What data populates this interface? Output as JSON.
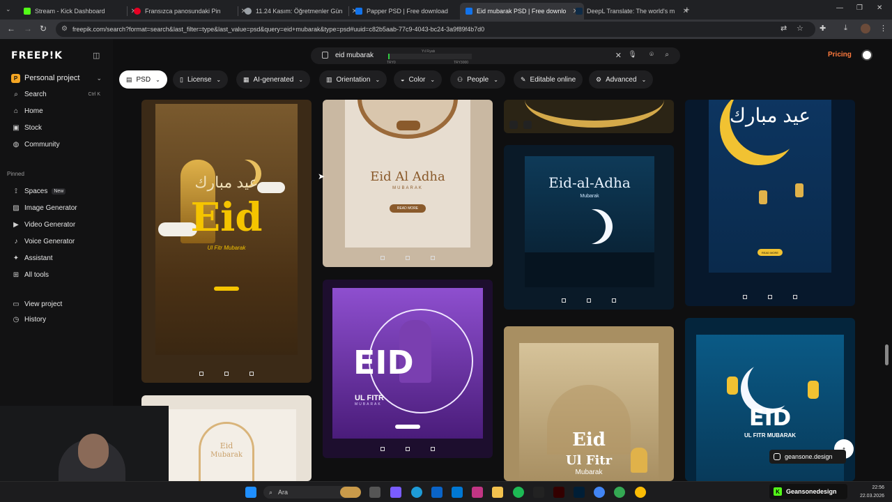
{
  "browser": {
    "tabs": [
      {
        "title": "Stream - Kick Dashboard",
        "icon": "kick-icon",
        "color": "#53fc18"
      },
      {
        "title": "Fransızca panosundaki Pin",
        "icon": "pinterest-icon",
        "color": "#e60023"
      },
      {
        "title": "11.24 Kasım: Öğretmenler Gün",
        "icon": "globe-icon",
        "color": "#9aa0a6"
      },
      {
        "title": "Papper PSD | Free download",
        "icon": "freepik-icon",
        "color": "#1273eb"
      },
      {
        "title": "Eid mubarak PSD | Free downlo",
        "icon": "freepik-icon",
        "color": "#1273eb"
      },
      {
        "title": "DeepL Translate: The world's m",
        "icon": "deepl-icon",
        "color": "#0f2b46"
      }
    ],
    "active_tab": 4,
    "url": "freepik.com/search?format=search&last_filter=type&last_value=psd&query=eid+mubarak&type=psd#uuid=c82b5aab-77c9-4043-bc24-3a9f89f4b7d0"
  },
  "app": {
    "logo": "FREEP!K",
    "project": {
      "label": "Personal project"
    },
    "nav": [
      {
        "label": "Search",
        "icon": "search-icon",
        "shortcut": "Ctrl K"
      },
      {
        "label": "Home",
        "icon": "home-icon"
      },
      {
        "label": "Stock",
        "icon": "stock-icon"
      },
      {
        "label": "Community",
        "icon": "globe-icon"
      }
    ],
    "pinned_label": "Pinned",
    "pinned": [
      {
        "label": "Spaces",
        "icon": "spaces-icon",
        "badge": "New"
      },
      {
        "label": "Image Generator",
        "icon": "image-icon"
      },
      {
        "label": "Video Generator",
        "icon": "video-icon"
      },
      {
        "label": "Voice Generator",
        "icon": "voice-icon"
      },
      {
        "label": "Assistant",
        "icon": "assistant-icon"
      },
      {
        "label": "All tools",
        "icon": "grid-icon"
      }
    ],
    "footer": [
      {
        "label": "View project",
        "icon": "project-icon"
      },
      {
        "label": "History",
        "icon": "history-icon"
      }
    ],
    "search": {
      "query": "eid mubarak"
    },
    "rate_widget": {
      "left": "TRY0",
      "right": "TRY3000",
      "top": "Yıl Fiyatı",
      "value_fraction": 0.02
    },
    "pricing": "Pricing",
    "filters": [
      {
        "label": "PSD",
        "icon": "file-icon",
        "active": true
      },
      {
        "label": "License",
        "icon": "license-icon"
      },
      {
        "label": "AI-generated",
        "icon": "ai-icon"
      },
      {
        "label": "Orientation",
        "icon": "orientation-icon"
      },
      {
        "label": "Color",
        "icon": "color-icon"
      },
      {
        "label": "People",
        "icon": "people-icon"
      },
      {
        "label": "Editable online",
        "icon": "pencil-icon",
        "no_chevron": true
      },
      {
        "label": "Advanced",
        "icon": "settings-icon"
      }
    ],
    "cards": [
      {
        "title": "Eid",
        "subtitle": "Ul Fitr Mubarak",
        "arabic": "عيد مبارك",
        "bg": "#5a3c1a",
        "accent": "#f5c400"
      },
      {
        "title": "Eid Al Adha",
        "subtitle": "MUBARAK",
        "button": "READ MORE",
        "bg": "#dccbb5",
        "accent": "#8a5a2b"
      },
      {
        "title": "Eid-al-Adha",
        "subtitle": "Mubarak",
        "bg": "#0b2a40",
        "accent": "#cfe8ff"
      },
      {
        "title": "عيد مبارك",
        "button": "READ MORE",
        "bg": "#0d3560",
        "accent": "#f5c400"
      },
      {
        "title": "EID",
        "subtitle": "UL FITR",
        "subtitle2": "MUBARAK",
        "bg": "#6a2a9e",
        "accent": "#ffffff"
      },
      {
        "title": "Eid",
        "subtitle": "Ul Fitr",
        "subtitle2": "Mubarak",
        "bg": "#c8b48a",
        "accent": "#ffffff"
      },
      {
        "title": "EID",
        "subtitle": "UL FITR MUBARAK",
        "bg": "#0a4a70",
        "accent": "#ffffff"
      },
      {
        "title": "Eid",
        "subtitle": "Mubarak",
        "bg": "#efe9e0",
        "accent": "#d9b47a"
      }
    ],
    "watermark": "geansone.design"
  },
  "taskbar": {
    "search": "Ara",
    "kick": "Geansonedesign",
    "time": "22:56",
    "date": "22.03.2026"
  }
}
